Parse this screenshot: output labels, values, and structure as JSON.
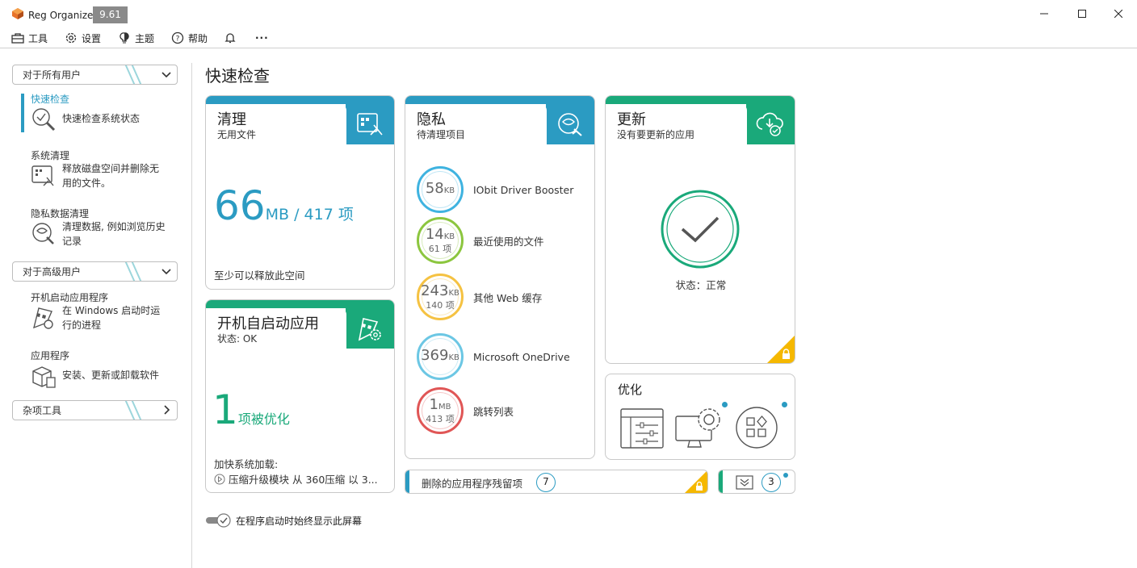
{
  "app": {
    "name": "Reg Organizer",
    "version": "9.61"
  },
  "menu": {
    "tools": "工具",
    "settings": "设置",
    "theme": "主题",
    "help": "帮助",
    "more": "···"
  },
  "sidebar": {
    "group1": "对于所有用户",
    "items1": [
      {
        "title": "快速检查",
        "desc": "快速检查系统状态",
        "active": true
      },
      {
        "title": "系统清理",
        "desc": "释放磁盘空间并删除无用的文件。"
      },
      {
        "title": "隐私数据清理",
        "desc": "清理数据, 例如浏览历史记录"
      }
    ],
    "group2": "对于高级用户",
    "items2": [
      {
        "title": "开机启动应用程序",
        "desc": "在 Windows 启动时运行的进程"
      },
      {
        "title": "应用程序",
        "desc": "安装、更新或卸载软件"
      }
    ],
    "group3": "杂项工具"
  },
  "main": {
    "title": "快速检查",
    "clean": {
      "title": "清理",
      "subtitle": "无用文件",
      "big": "66",
      "rest": "MB / 417 项",
      "footer": "至少可以释放此空间"
    },
    "privacy": {
      "title": "隐私",
      "subtitle": "待清理项目",
      "items": [
        {
          "size": "58",
          "unit": "KB",
          "count": "",
          "label": "IObit Driver Booster",
          "color": "#3fb3e0"
        },
        {
          "size": "14",
          "unit": "KB",
          "count": "61 项",
          "label": "最近使用的文件",
          "color": "#8cc63f"
        },
        {
          "size": "243",
          "unit": "KB",
          "count": "140 项",
          "label": "其他 Web 缓存",
          "color": "#f5c242"
        },
        {
          "size": "369",
          "unit": "KB",
          "count": "",
          "label": "Microsoft OneDrive",
          "color": "#6cc7e4"
        },
        {
          "size": "1",
          "unit": "MB",
          "count": "413 项",
          "label": "跳转列表",
          "color": "#e05656"
        }
      ]
    },
    "update": {
      "title": "更新",
      "subtitle": "没有要更新的应用",
      "status": "状态：正常"
    },
    "startup": {
      "title": "开机自启动应用",
      "subtitle": "状态: OK",
      "big": "1",
      "rest": "项被优化",
      "footer_title": "加快系统加载:",
      "footer_item": "压缩升级模块 从 360压缩 以 3..."
    },
    "optimize": {
      "title": "优化"
    },
    "leftovers": {
      "label": "删除的应用程序残留项",
      "count": "7"
    },
    "mini": {
      "count": "3"
    },
    "show_on_start": "在程序启动时始终显示此屏幕"
  },
  "colors": {
    "blue": "#2b9bc2",
    "green": "#1aa97a",
    "yellow": "#f5b800"
  }
}
